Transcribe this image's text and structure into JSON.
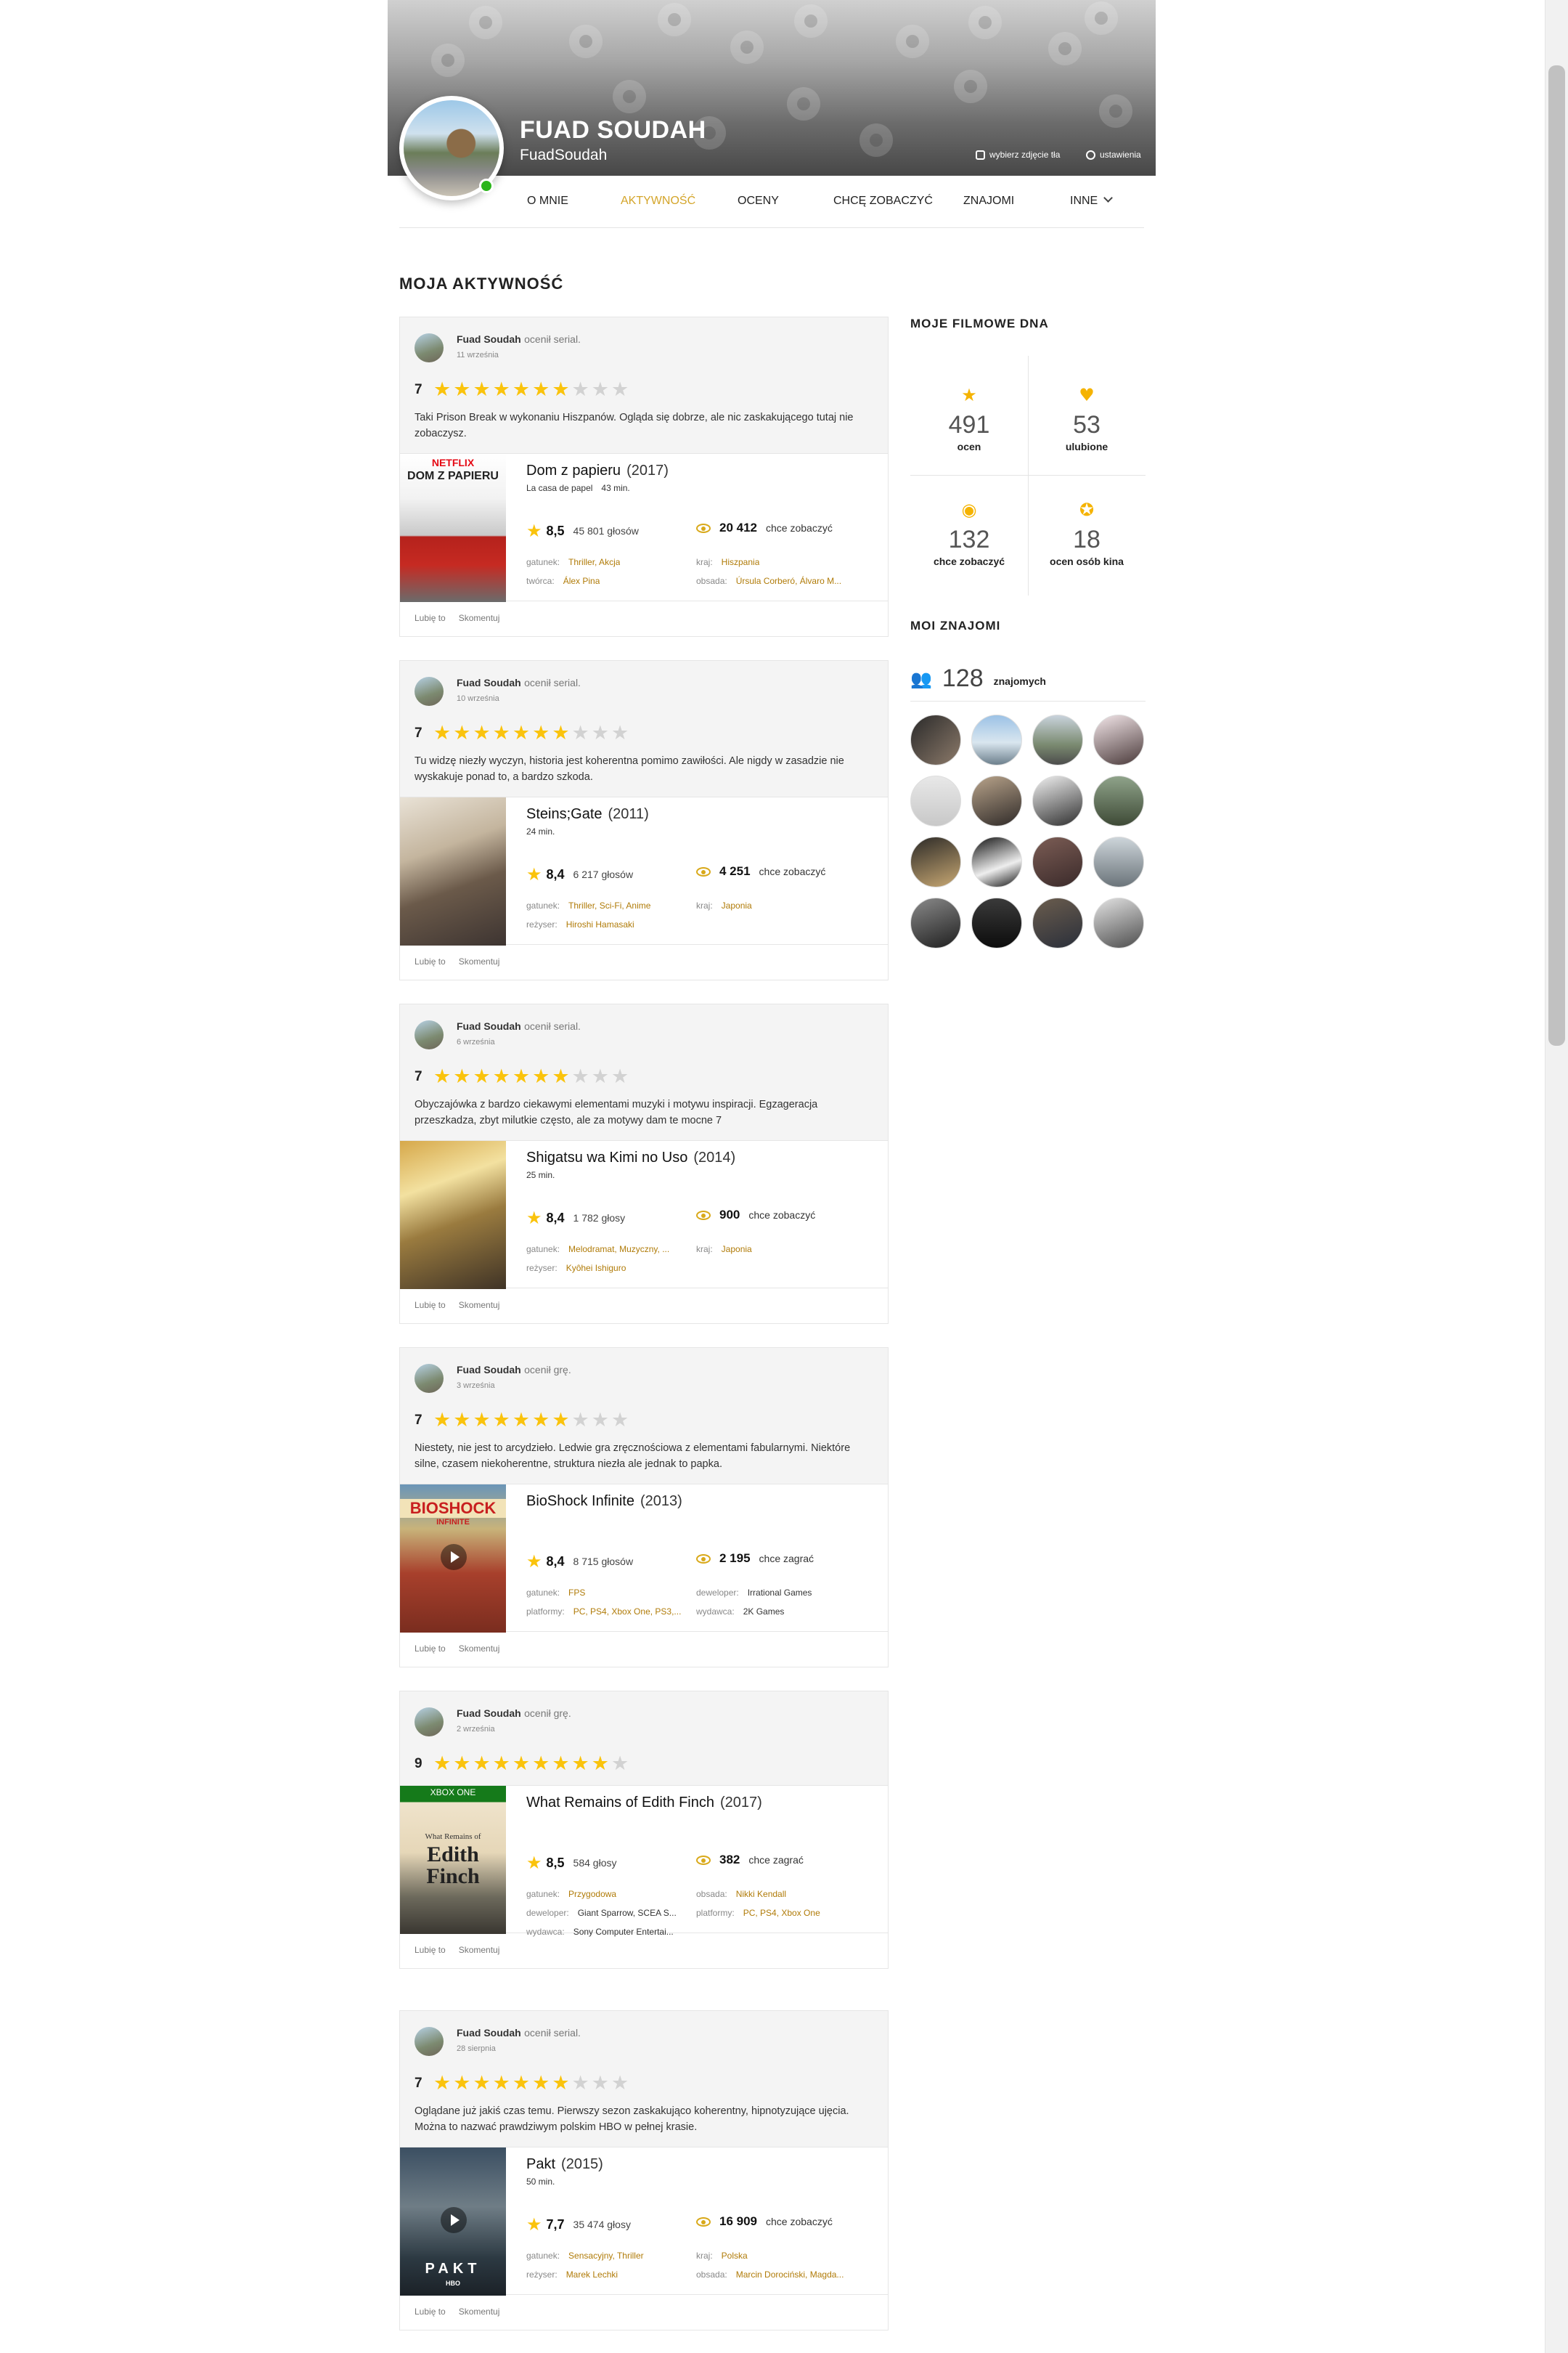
{
  "profile": {
    "name": "FUAD SOUDAH",
    "login": "FuadSoudah",
    "choose_bg": "wybierz zdjęcie tła",
    "settings": "ustawienia"
  },
  "tabs": [
    "O MNIE",
    "AKTYWNOŚĆ",
    "OCENY",
    "CHCĘ ZOBACZYĆ",
    "ZNAJOMI",
    "INNE"
  ],
  "active_tab": "AKTYWNOŚĆ",
  "section_title": "MOJA AKTYWNOŚĆ",
  "actions": {
    "like": "Lubię to",
    "comment": "Skomentuj"
  },
  "activities": [
    {
      "user": "Fuad Soudah",
      "action": "ocenił serial.",
      "date": "11 września",
      "rating": "7",
      "stars": 7,
      "comment": "Taki Prison Break w wykonaniu Hiszpanów. Ogląda się dobrze, ale nic zaskakującego tutaj nie zobaczysz.",
      "title": "Dom z papieru",
      "year": "(2017)",
      "original": "La casa de papel",
      "duration": "43 min.",
      "score": "8,5",
      "votes": "45 801 głosów",
      "want": "20 412",
      "want_label": "chce zobaczyć",
      "meta": [
        {
          "k": "gatunek:",
          "v": "Thriller, Akcja"
        },
        {
          "k": "kraj:",
          "v": "Hiszpania"
        },
        {
          "k": "twórca:",
          "v": "Álex Pina"
        },
        {
          "k": "obsada:",
          "v": "Úrsula Corberó, Álvaro M..."
        }
      ],
      "poster_text": [
        "NETFLIX",
        "DOM Z PAPIERU"
      ]
    },
    {
      "user": "Fuad Soudah",
      "action": "ocenił serial.",
      "date": "10 września",
      "rating": "7",
      "stars": 7,
      "comment": "Tu widzę niezły wyczyn, historia jest koherentna pomimo zawiłości. Ale nigdy w zasadzie nie wyskakuje ponad to, a bardzo szkoda.",
      "title": "Steins;Gate",
      "year": "(2011)",
      "original": "",
      "duration": "24 min.",
      "score": "8,4",
      "votes": "6 217 głosów",
      "want": "4 251",
      "want_label": "chce zobaczyć",
      "meta": [
        {
          "k": "gatunek:",
          "v": "Thriller, Sci-Fi, Anime"
        },
        {
          "k": "kraj:",
          "v": "Japonia"
        },
        {
          "k": "reżyser:",
          "v": "Hiroshi Hamasaki"
        }
      ],
      "poster_text": []
    },
    {
      "user": "Fuad Soudah",
      "action": "ocenił serial.",
      "date": "6 września",
      "rating": "7",
      "stars": 7,
      "comment": "Obyczajówka z bardzo ciekawymi elementami muzyki i motywu inspiracji. Egzageracja przeszkadza, zbyt milutkie często, ale za motywy dam te mocne 7",
      "title": "Shigatsu wa Kimi no Uso",
      "year": "(2014)",
      "original": "",
      "duration": "25 min.",
      "score": "8,4",
      "votes": "1 782 głosy",
      "want": "900",
      "want_label": "chce zobaczyć",
      "meta": [
        {
          "k": "gatunek:",
          "v": "Melodramat, Muzyczny, ..."
        },
        {
          "k": "kraj:",
          "v": "Japonia"
        },
        {
          "k": "reżyser:",
          "v": "Kyôhei Ishiguro"
        }
      ],
      "poster_text": []
    },
    {
      "user": "Fuad Soudah",
      "action": "ocenił grę.",
      "date": "3 września",
      "rating": "7",
      "stars": 7,
      "comment": "Niestety, nie jest to arcydzieło. Ledwie gra zręcznościowa z elementami fabularnymi. Niektóre silne, czasem niekoherentne, struktura niezła ale jednak to papka.",
      "title": "BioShock Infinite",
      "year": "(2013)",
      "original": "",
      "duration": "",
      "score": "8,4",
      "votes": "8 715 głosów",
      "want": "2 195",
      "want_label": "chce zagrać",
      "meta": [
        {
          "k": "gatunek:",
          "v": "FPS"
        },
        {
          "k": "deweloper:",
          "v": "Irrational Games",
          "plain": true
        },
        {
          "k": "platformy:",
          "v": "PC, PS4, Xbox One, PS3,..."
        },
        {
          "k": "wydawca:",
          "v": "2K Games",
          "plain": true
        }
      ],
      "poster_text": [
        "BIOSHOCK",
        "INFINITE"
      ]
    },
    {
      "user": "Fuad Soudah",
      "action": "ocenił grę.",
      "date": "2 września",
      "rating": "9",
      "stars": 9,
      "comment": "",
      "title": "What Remains of Edith Finch",
      "year": "(2017)",
      "original": "",
      "duration": "",
      "score": "8,5",
      "votes": "584 głosy",
      "want": "382",
      "want_label": "chce zagrać",
      "meta": [
        {
          "k": "gatunek:",
          "v": "Przygodowa"
        },
        {
          "k": "obsada:",
          "v": "Nikki Kendall"
        },
        {
          "k": "deweloper:",
          "v": "Giant Sparrow, SCEA S...",
          "plain": true
        },
        {
          "k": "platformy:",
          "v": "PC, PS4, Xbox One"
        },
        {
          "k": "wydawca:",
          "v": "Sony Computer Entertai...",
          "plain": true
        }
      ],
      "poster_text": [
        "XBOX ONE",
        "What Remains of",
        "Edith",
        "Finch"
      ]
    },
    {
      "user": "Fuad Soudah",
      "action": "ocenił serial.",
      "date": "28 sierpnia",
      "rating": "7",
      "stars": 7,
      "comment": "Oglądane już jakiś czas temu. Pierwszy sezon zaskakująco koherentny, hipnotyzujące ujęcia. Można to nazwać prawdziwym polskim HBO w pełnej krasie.",
      "title": "Pakt",
      "year": "(2015)",
      "original": "",
      "duration": "50 min.",
      "score": "7,7",
      "votes": "35 474 głosy",
      "want": "16 909",
      "want_label": "chce zobaczyć",
      "meta": [
        {
          "k": "gatunek:",
          "v": "Sensacyjny, Thriller"
        },
        {
          "k": "kraj:",
          "v": "Polska"
        },
        {
          "k": "reżyser:",
          "v": "Marek Lechki"
        },
        {
          "k": "obsada:",
          "v": "Marcin Dorociński, Magda..."
        }
      ],
      "poster_text": [
        "PAKT",
        "HBO"
      ]
    }
  ],
  "sidebar": {
    "dna_title": "MOJE FILMOWE DNA",
    "stats": [
      {
        "icon": "star-icon",
        "num": "491",
        "label": "ocen"
      },
      {
        "icon": "heart-icon",
        "num": "53",
        "label": "ulubione"
      },
      {
        "icon": "eye-icon",
        "num": "132",
        "label": "chce zobaczyć"
      },
      {
        "icon": "badge-icon",
        "num": "18",
        "label": "ocen osób kina"
      }
    ],
    "friends_title": "MOI ZNAJOMI",
    "friends_count": "128",
    "friends_label": "znajomych",
    "friend_count_shown": 16
  },
  "colors": {
    "accent": "#d4a52a",
    "star": "#fac30c",
    "link": "#b07b08"
  }
}
